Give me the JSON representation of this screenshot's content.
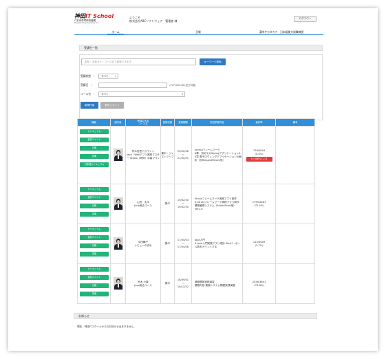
{
  "header": {
    "logo_brand": "神田",
    "logo_highlight": "IT School",
    "logo_sub": "IT未来専門研修機関",
    "logo_sub2": "Programming Academy Inc.",
    "welcome": "ようこそ",
    "company_user": "株式会社ABCソフトウェア　管理者 様",
    "logout_label": "ログアウト"
  },
  "nav": {
    "home": "ホーム",
    "report": "日報",
    "kana": "漢字やカタカナ・日本語能力試験練習"
  },
  "search": {
    "section_title": "受講生一覧",
    "placeholder": "名前・名前カナ・コース名で検索できます",
    "keyword_button": "キーワード検索",
    "status_label": "受講状態　：",
    "status_value": "すべて",
    "date_label": "受講日　：",
    "date_hint": "(YYYY-MM-DD,空白可能)",
    "course_label": "コース名　：",
    "course_value": "すべて",
    "new_button": "新規作成",
    "reset_button": "条件リセット"
  },
  "table": {
    "headers": [
      "機能",
      "顔写真",
      "受講生氏名\nコース名",
      "受講状態",
      "受講期間",
      "前回学習内容",
      "進捗率",
      "備考"
    ],
    "action_labels": [
      "カリキュラム",
      "進捗コメント",
      "日報",
      "答案",
      "日本語カリキュラム"
    ],
    "rows": [
      {
        "name": "鈴木信吾アカウント",
        "course": "Java・Webアプリ実践マスター 3class（研修）中級プラン",
        "status": "集中・ジャストアップ",
        "period_start": "20/02/06",
        "period_sep": "～",
        "period_end": "21/02/01",
        "content_line1": "Springフレームワーク",
        "content_line2": "4章：初めてのSpringアプリケーション4-3章 電子ロヴィングアプリケーションの解析（@RequestParam他）",
        "progress_count": "178/4044",
        "progress_pct": "(4.4%)",
        "progress_badge": "3ヶ月遅れている"
      },
      {
        "name": "山田　太平",
        "course": "Java総合コース",
        "status": "集中",
        "period_start": "19/02/20",
        "period_sep": "～",
        "period_end": "19/02/20",
        "content_line1": "Strutsフレームワーク実践アプリ制作",
        "content_line2": "4-Strutsフレームワーク実践アプリ制作 業務管理システム（ActionForm他）Ver1.0",
        "progress_count": "1799/2481",
        "progress_pct": "(72.4%)",
        "progress_badge": ""
      },
      {
        "name": "中田舞子",
        "course": "レビューの流れ",
        "status": "集中",
        "period_start": "17/04/03",
        "period_sep": "～",
        "period_end": "17/04/08",
        "content_line1": "Java入門",
        "content_line2": "4-Java入門実践アプリ成形 Step7・ボール数をカウントする",
        "progress_count": "114/3049",
        "progress_pct": "(3.7%)",
        "progress_badge": ""
      },
      {
        "name": "鈴木 小春",
        "course": "Java総合コース",
        "status": "集中",
        "period_start": "16/09/01",
        "period_sep": "～",
        "period_end": "16/12/22",
        "content_line1": "業務開発実践演習",
        "content_line2": "業務内容 業務システム開発実践演習",
        "progress_count": "2026/3641",
        "progress_pct": "(73.8%)",
        "progress_badge": ""
      }
    ]
  },
  "notice": {
    "title": "お知らせ",
    "text": "現在、神田ITスクールからのお知らせはありません。"
  }
}
